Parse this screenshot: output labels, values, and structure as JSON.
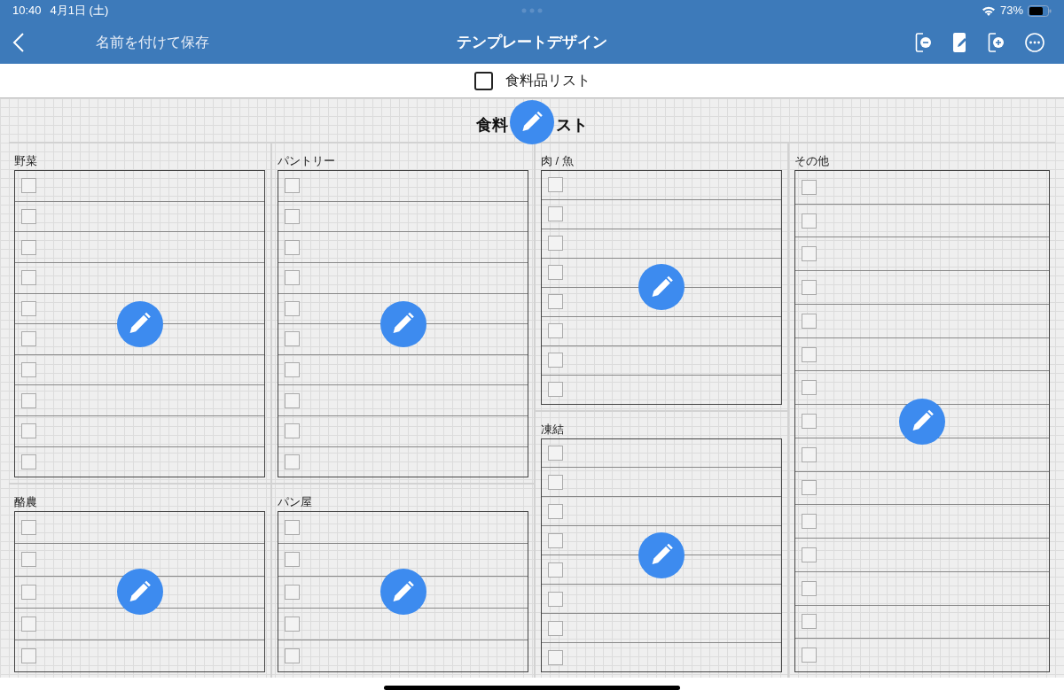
{
  "status_bar": {
    "time": "10:40",
    "date": "4月1日 (土)",
    "battery": "73%"
  },
  "nav_bar": {
    "back_label": "名前を付けて保存",
    "title": "テンプレートデザイン"
  },
  "template_toggle": {
    "label": "食料品リスト",
    "checked": false
  },
  "sheet": {
    "title_start": "食料",
    "title_end": "スト",
    "columns": [
      {
        "sections": [
          {
            "label": "野菜",
            "items": [
              {
                "checked": false
              },
              {
                "checked": false
              },
              {
                "checked": false
              },
              {
                "checked": false
              },
              {
                "checked": false
              },
              {
                "checked": false
              },
              {
                "checked": false
              },
              {
                "checked": false
              },
              {
                "checked": false
              },
              {
                "checked": false
              }
            ]
          },
          {
            "label": "酪農",
            "items": [
              {
                "checked": false
              },
              {
                "checked": false
              },
              {
                "checked": false
              },
              {
                "checked": false
              },
              {
                "checked": false
              }
            ]
          }
        ]
      },
      {
        "sections": [
          {
            "label": "パントリー",
            "items": [
              {
                "checked": false
              },
              {
                "checked": false
              },
              {
                "checked": false
              },
              {
                "checked": false
              },
              {
                "checked": false
              },
              {
                "checked": false
              },
              {
                "checked": false
              },
              {
                "checked": false
              },
              {
                "checked": false
              },
              {
                "checked": false
              }
            ]
          },
          {
            "label": "パン屋",
            "items": [
              {
                "checked": false
              },
              {
                "checked": false
              },
              {
                "checked": false
              },
              {
                "checked": false
              },
              {
                "checked": false
              }
            ]
          }
        ]
      },
      {
        "sections": [
          {
            "label": "肉 / 魚",
            "items": [
              {
                "checked": false
              },
              {
                "checked": false
              },
              {
                "checked": false
              },
              {
                "checked": false
              },
              {
                "checked": false
              },
              {
                "checked": false
              },
              {
                "checked": false
              },
              {
                "checked": false
              }
            ]
          },
          {
            "label": "凍結",
            "items": [
              {
                "checked": false
              },
              {
                "checked": false
              },
              {
                "checked": false
              },
              {
                "checked": false
              },
              {
                "checked": false
              },
              {
                "checked": false
              },
              {
                "checked": false
              },
              {
                "checked": false
              }
            ]
          }
        ]
      },
      {
        "sections": [
          {
            "label": "その他",
            "items": [
              {
                "checked": false
              },
              {
                "checked": false
              },
              {
                "checked": false
              },
              {
                "checked": false
              },
              {
                "checked": false
              },
              {
                "checked": false
              },
              {
                "checked": false
              },
              {
                "checked": false
              },
              {
                "checked": false
              },
              {
                "checked": false
              },
              {
                "checked": false
              },
              {
                "checked": false
              },
              {
                "checked": false
              },
              {
                "checked": false
              },
              {
                "checked": false
              }
            ]
          }
        ]
      }
    ]
  }
}
